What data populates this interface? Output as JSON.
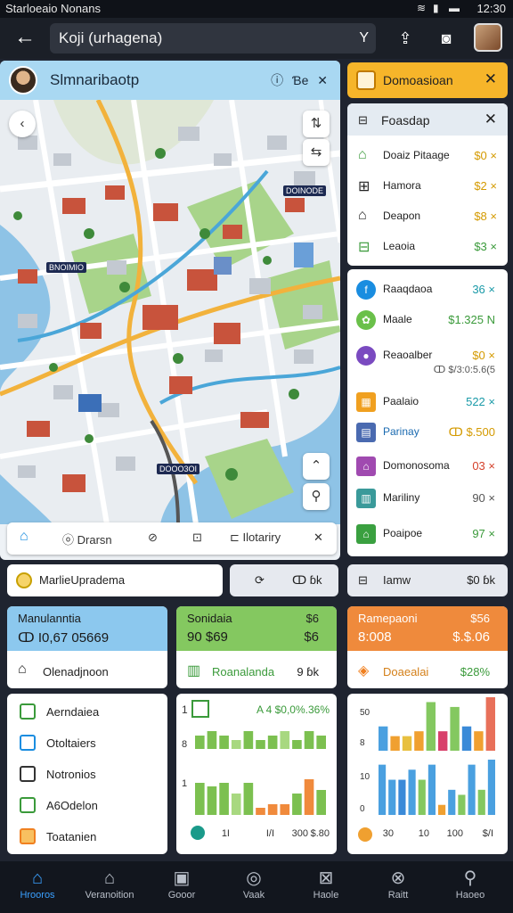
{
  "status": {
    "left": "Starloeaio Nonans",
    "right": "12:30"
  },
  "topbar": {
    "search_value": "Koji (urhagena)"
  },
  "map": {
    "title": "Slmnaribaotp",
    "header_right": "Ɓe",
    "labels": [
      "DOINODE",
      "BNOIMIO",
      "DOOO3OI"
    ],
    "toolbar": {
      "item1": "Drarsn",
      "item2": "Ilotariry"
    }
  },
  "right_top": {
    "title": "Domoasioan"
  },
  "right_list": {
    "header": "Foasdap",
    "items": [
      {
        "icon": "home-icon",
        "label": "Doaiz Pitaage",
        "value": "$0 ×",
        "color": "#d49a00"
      },
      {
        "icon": "grid-icon",
        "label": "Hamora",
        "value": "$2 ×",
        "color": "#d49a00"
      },
      {
        "icon": "tag-icon",
        "label": "Deapon",
        "value": "$8 ×",
        "color": "#d49a00"
      },
      {
        "icon": "list-icon",
        "label": "Leaoia",
        "value": "$3 ×",
        "color": "#3a9a3a"
      }
    ]
  },
  "right_list2": {
    "items": [
      {
        "label": "Raaqdaoa",
        "value": "36 ×",
        "color": "#1a9aa8",
        "icon_color": "#1a8de0",
        "icon": "f"
      },
      {
        "label": "Maale",
        "value": "$1.325 N",
        "color": "#3a9a3a",
        "icon_color": "#6ac04a",
        "icon": "✿"
      },
      {
        "label": "Reaoalber",
        "value": "$0 ×",
        "color": "#d49a00",
        "icon_color": "#7a4ac0",
        "icon": "●",
        "sub": "ↀ $/3:0:5.6(5"
      },
      {
        "label": "Paalaio",
        "value": "522 ×",
        "color": "#1a9aa8",
        "icon_color": "#f0a020",
        "icon": "▦"
      },
      {
        "label": "Parinay",
        "value": "ↀ $.500",
        "color": "#d49a00",
        "icon_color": "#4a6ab0",
        "icon": "▤"
      },
      {
        "label": "Domonosoma",
        "value": "03 ×",
        "color": "#d4402a",
        "icon_color": "#a04ab0",
        "icon": "⌂"
      },
      {
        "label": "Mariliny",
        "value": "90 ×",
        "color": "#555555",
        "icon_color": "#3a9a9a",
        "icon": "▥"
      },
      {
        "label": "Poaipoe",
        "value": "97 ×",
        "color": "#3a9a3a",
        "icon_color": "#3aa040",
        "icon": "⌂"
      }
    ]
  },
  "mid": {
    "strip1": "MarlieUpradema",
    "strip2_left": "ↀ",
    "strip2_right": "ↀ ɓk",
    "strip3_label": "Iamw",
    "strip3_value": "$0 ɓk"
  },
  "stats": [
    {
      "title": "Manulanntia",
      "value": "ↀ I0,67 05669",
      "r1": "",
      "r2": "",
      "head_color": "#8cc8ee",
      "sub_label": "Olenadjnoon",
      "sub_value": ""
    },
    {
      "title": "Sonidaia",
      "value": "90 $69",
      "r1": "$6",
      "r2": "$6",
      "head_color": "#84c860",
      "sub_label": "Roanalanda",
      "sub_value": "9 ɓk"
    },
    {
      "title": "Ramepaoni",
      "value": "8:008",
      "r1": "$56",
      "r2": "$.$.06",
      "head_color": "#ef8a3c",
      "sub_label": "Doaealai",
      "sub_value": "$28%"
    }
  ],
  "nav_list": [
    {
      "label": "Aerndaiea",
      "color": "#3a9a3a"
    },
    {
      "label": "Otoltaiers",
      "color": "#1a8de0"
    },
    {
      "label": "Notronios",
      "color": "#333333"
    },
    {
      "label": "A6Odelon",
      "color": "#3a9a3a"
    },
    {
      "label": "Toatanien",
      "color": "#f08020"
    }
  ],
  "chart_green": {
    "header_left": "1",
    "header_right": "A 4 $0,0%.36%",
    "row2_label": "8",
    "bottom_ticks": [
      "1I",
      "I/I",
      "300",
      "$.80"
    ],
    "chart_data": {
      "type": "bar",
      "series": [
        {
          "name": "",
          "values": [
            3,
            4,
            3,
            2,
            4,
            2,
            3,
            4,
            2,
            4,
            3
          ]
        },
        {
          "name": "",
          "values": [
            9,
            8,
            9,
            6,
            9,
            2,
            3,
            3,
            6,
            10,
            7
          ]
        }
      ]
    }
  },
  "chart_orange": {
    "header_right": "$28%",
    "y_ticks": [
      "50",
      "8",
      "10",
      "0"
    ],
    "bottom_ticks": [
      "30",
      "10",
      "100",
      "$/I"
    ],
    "chart_data": {
      "type": "bar",
      "series": [
        {
          "name": "",
          "values": [
            5,
            3,
            3,
            4,
            10,
            4,
            9,
            5,
            4,
            11
          ]
        },
        {
          "name": "",
          "values": [
            10,
            7,
            7,
            9,
            7,
            10,
            2,
            5,
            4,
            10,
            5,
            11
          ]
        }
      ]
    }
  },
  "bottom_nav": [
    {
      "label": "Hrooros",
      "icon": "⌂",
      "active": true
    },
    {
      "label": "Veranoition",
      "icon": "⌂",
      "active": false
    },
    {
      "label": "Gooor",
      "icon": "▣",
      "active": false
    },
    {
      "label": "Vaak",
      "icon": "◎",
      "active": false
    },
    {
      "label": "Haole",
      "icon": "⊠",
      "active": false
    },
    {
      "label": "Raitt",
      "icon": "⊗",
      "active": false
    },
    {
      "label": "Haoeo",
      "icon": "⚲",
      "active": false
    }
  ]
}
